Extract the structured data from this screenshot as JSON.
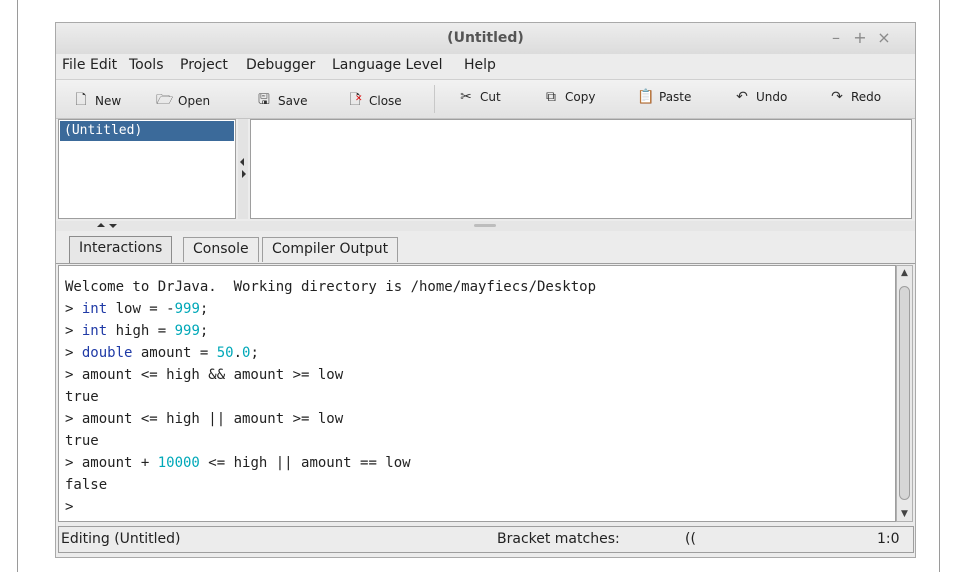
{
  "window": {
    "title": "(Untitled)",
    "controls": [
      "–",
      "+",
      "×"
    ]
  },
  "menu": [
    "File",
    "Edit",
    "Tools",
    "Project",
    "Debugger",
    "Language Level",
    "Help"
  ],
  "toolbar": [
    {
      "label": "New",
      "icon": "new-file-icon"
    },
    {
      "label": "Open",
      "icon": "folder-open-icon"
    },
    {
      "label": "Save",
      "icon": "floppy-disk-icon"
    },
    {
      "label": "Close",
      "icon": "close-file-icon"
    },
    {
      "label": "Cut",
      "icon": "scissors-icon"
    },
    {
      "label": "Copy",
      "icon": "copy-icon"
    },
    {
      "label": "Paste",
      "icon": "clipboard-icon"
    },
    {
      "label": "Undo",
      "icon": "undo-icon"
    },
    {
      "label": "Redo",
      "icon": "redo-icon"
    }
  ],
  "documents": [
    "(Untitled)"
  ],
  "tabs": [
    "Interactions",
    "Console",
    "Compiler Output"
  ],
  "console_lines": [
    [
      {
        "t": "Welcome to DrJava.  Working directory is /home/mayfiecs/Desktop",
        "c": ""
      }
    ],
    [
      {
        "t": "> ",
        "c": ""
      },
      {
        "t": "int",
        "c": "kw"
      },
      {
        "t": " low = -",
        "c": ""
      },
      {
        "t": "999",
        "c": "num"
      },
      {
        "t": ";",
        "c": ""
      }
    ],
    [
      {
        "t": "> ",
        "c": ""
      },
      {
        "t": "int",
        "c": "kw"
      },
      {
        "t": " high = ",
        "c": ""
      },
      {
        "t": "999",
        "c": "num"
      },
      {
        "t": ";",
        "c": ""
      }
    ],
    [
      {
        "t": "> ",
        "c": ""
      },
      {
        "t": "double",
        "c": "kw"
      },
      {
        "t": " amount = ",
        "c": ""
      },
      {
        "t": "50",
        "c": "num"
      },
      {
        "t": ".",
        "c": ""
      },
      {
        "t": "0",
        "c": "num"
      },
      {
        "t": ";",
        "c": ""
      }
    ],
    [
      {
        "t": "> amount <= high && amount >= low",
        "c": ""
      }
    ],
    [
      {
        "t": "true",
        "c": ""
      }
    ],
    [
      {
        "t": "> amount <= high || amount >= low",
        "c": ""
      }
    ],
    [
      {
        "t": "true",
        "c": ""
      }
    ],
    [
      {
        "t": "> amount + ",
        "c": ""
      },
      {
        "t": "10000",
        "c": "num"
      },
      {
        "t": " <= high || amount == low",
        "c": ""
      }
    ],
    [
      {
        "t": "false",
        "c": ""
      }
    ],
    [
      {
        "t": ">",
        "c": ""
      }
    ]
  ],
  "colors": {
    "keyword": "#1f3aa6",
    "number": "#00a8b8",
    "selection": "#3b6a9a"
  },
  "status": {
    "left": "Editing (Untitled)",
    "bracket_label": "Bracket matches:",
    "bracket_value": "((",
    "position": "1:0"
  }
}
